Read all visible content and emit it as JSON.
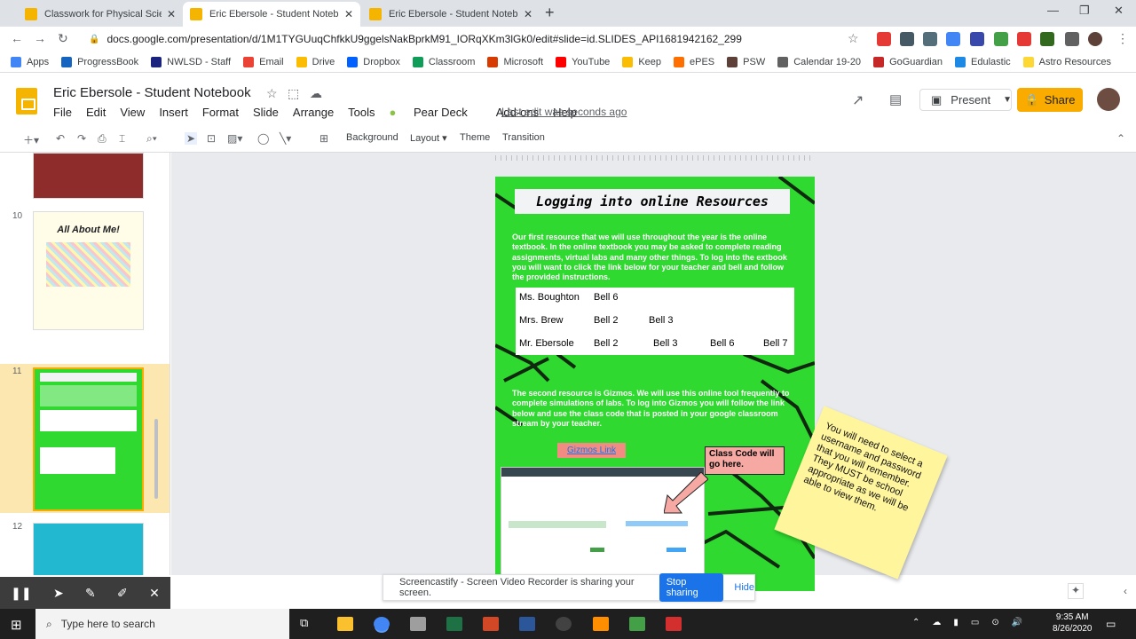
{
  "browser": {
    "tabs": [
      {
        "label": "Classwork for Physical Science B...",
        "active": false
      },
      {
        "label": "Eric Ebersole - Student Notebook",
        "active": true
      },
      {
        "label": "Eric Ebersole - Student Notebook",
        "active": false
      }
    ],
    "url": "docs.google.com/presentation/d/1M1TYGUuqChfkkU9ggelsNakBprkM91_IORqXKm3lGk0/edit#slide=id.SLIDES_API1681942162_299",
    "bookmarks": [
      "Apps",
      "ProgressBook",
      "NWLSD - Staff",
      "Email",
      "Drive",
      "Dropbox",
      "Classroom",
      "Microsoft",
      "YouTube",
      "Keep",
      "ePES",
      "PSW",
      "Calendar 19-20",
      "GoGuardian",
      "Edulastic",
      "Astro Resources"
    ]
  },
  "doc": {
    "title": "Eric Ebersole - Student Notebook",
    "menu": [
      "File",
      "Edit",
      "View",
      "Insert",
      "Format",
      "Slide",
      "Arrange",
      "Tools",
      "Pear Deck",
      "Add-ons",
      "Help"
    ],
    "last_edit": "Last edit was seconds ago",
    "present": "Present",
    "share": "Share"
  },
  "toolbar": {
    "background": "Background",
    "layout": "Layout",
    "theme": "Theme",
    "transition": "Transition"
  },
  "filmstrip": {
    "numbers": [
      "10",
      "11",
      "12"
    ],
    "thumb10_title": "All About Me!"
  },
  "slide": {
    "title": "Logging into online Resources",
    "para1": "Our first resource that we will use throughout the year is the online textbook. In the online textbook you may be asked to complete reading assignments, virtual labs and many other things. To log into the extbook you will want to click the link below for your teacher and bell and follow the provided instructions.",
    "table": [
      [
        "Ms. Boughton",
        "Bell 6",
        "",
        "",
        ""
      ],
      [
        "Mrs. Brew",
        "Bell 2",
        "Bell 3",
        "",
        ""
      ],
      [
        "Mr. Ebersole",
        "Bell 2",
        "Bell 3",
        "Bell 6",
        "Bell 7"
      ]
    ],
    "para2": "The second resource is Gizmos. We will use this online tool frequently to complete simulations of labs. To log into Gizmos you will follow the link below and use the class code that is posted in your google classroom stream by your teacher.",
    "gizmos_link": "Gizmos Link",
    "class_code_note": "Class Code will go here.",
    "sticky_note": "You will need to select a username and password that you will remember. They MUST be school appropriate as we will be able to view them."
  },
  "screencastify": {
    "message": "Screencastify - Screen Video Recorder is sharing your screen.",
    "stop": "Stop sharing",
    "hide": "Hide"
  },
  "taskbar": {
    "search_placeholder": "Type here to search",
    "time": "9:35 AM",
    "date": "8/26/2020"
  }
}
